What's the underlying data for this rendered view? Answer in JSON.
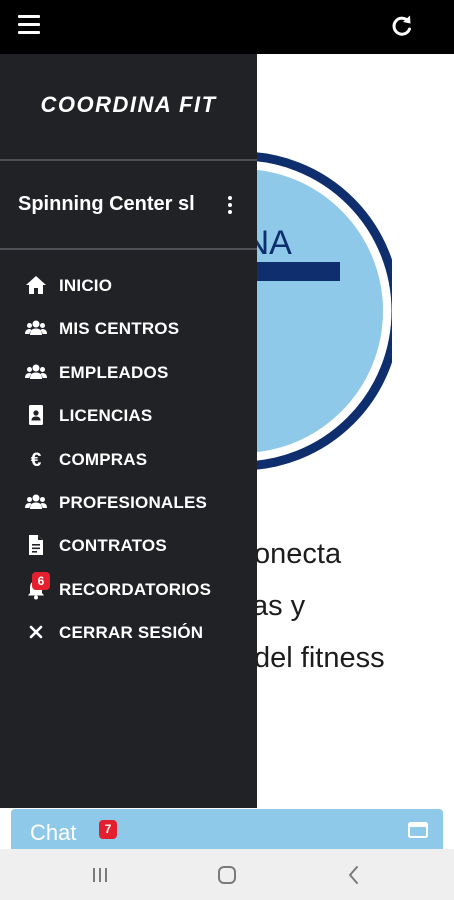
{
  "topbar": {
    "menu_icon": "hamburger-menu-icon",
    "refresh_icon": "refresh-icon",
    "background_color": "#000000"
  },
  "background": {
    "logo_text": "ODINA",
    "logo_letter": "T",
    "hero_lines": [
      "onecta",
      "as y",
      "del fitness"
    ],
    "logo_ring_color": "#0e2e6e",
    "logo_fill_color": "#8fc9ea"
  },
  "drawer": {
    "brand": "COORDINA FIT",
    "account_name": "Spinning Center sl",
    "account_menu_icon": "kebab-menu-icon",
    "items": [
      {
        "label": "INICIO",
        "icon": "home-icon"
      },
      {
        "label": "MIS CENTROS",
        "icon": "users-icon"
      },
      {
        "label": "EMPLEADOS",
        "icon": "users-icon"
      },
      {
        "label": "LICENCIAS",
        "icon": "id-card-icon"
      },
      {
        "label": "COMPRAS",
        "icon": "euro-icon"
      },
      {
        "label": "PROFESIONALES",
        "icon": "users-icon"
      },
      {
        "label": "CONTRATOS",
        "icon": "document-icon"
      },
      {
        "label": "RECORDATORIOS",
        "icon": "bell-icon",
        "badge": "6"
      },
      {
        "label": "CERRAR SESIÓN",
        "icon": "close-icon"
      }
    ],
    "background_color": "#212226"
  },
  "chat": {
    "label": "Chat",
    "badge": "7",
    "icon": "window-icon",
    "background_color": "#8fc9ea"
  },
  "system_nav": {
    "buttons": [
      "recent-apps-icon",
      "home-icon",
      "back-icon"
    ]
  }
}
